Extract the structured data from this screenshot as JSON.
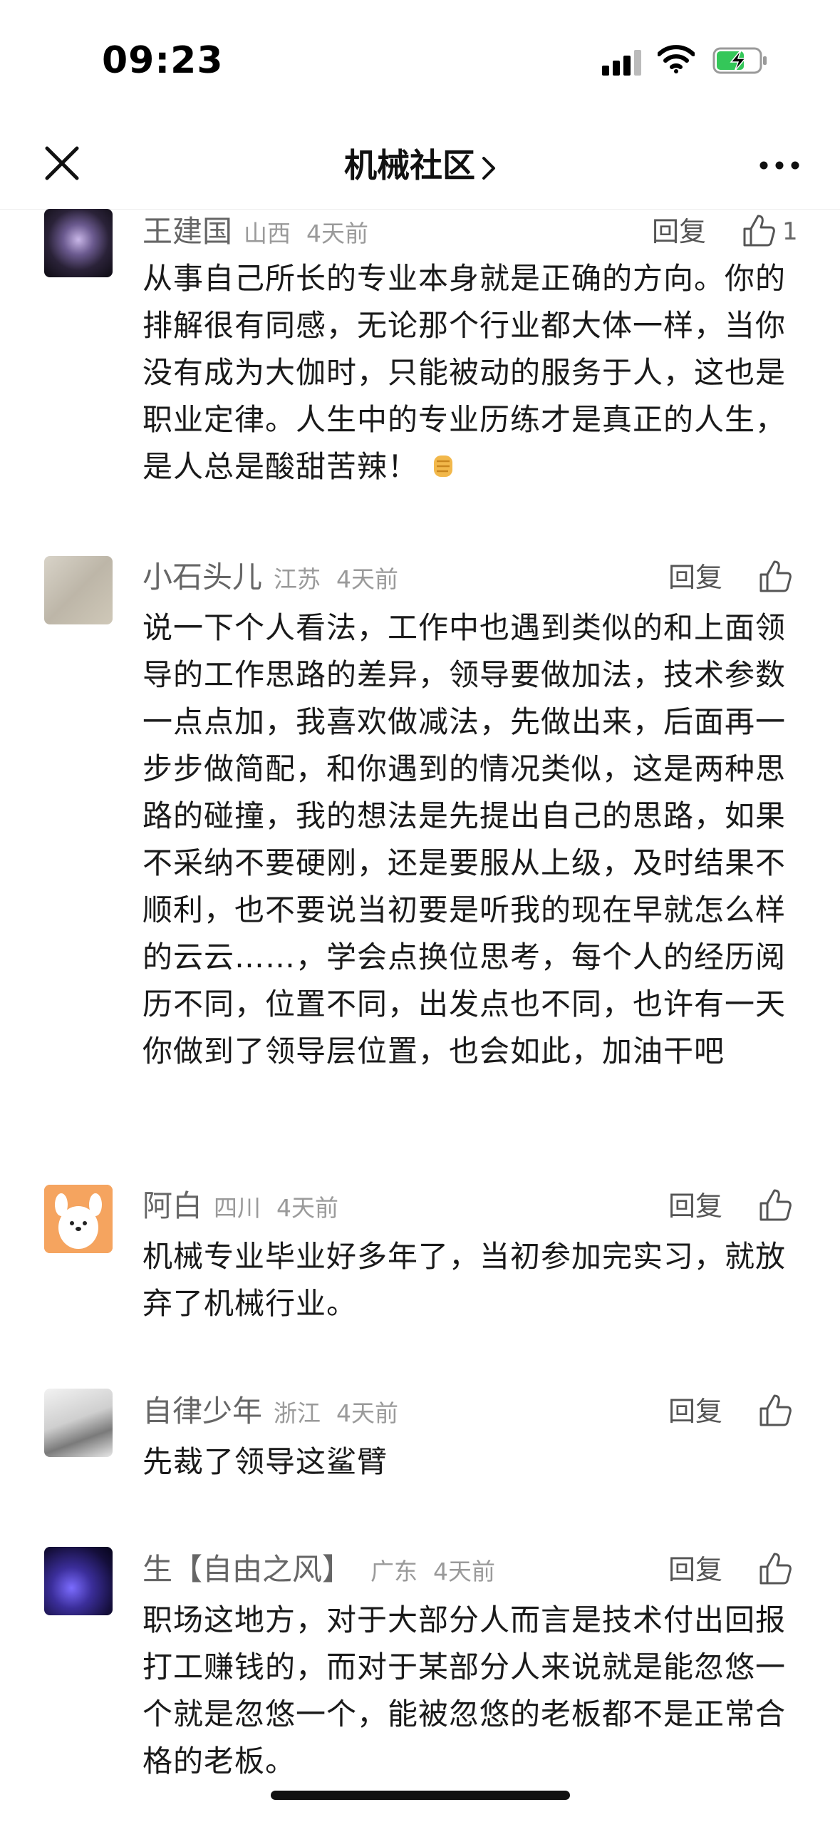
{
  "status": {
    "time": "09:23"
  },
  "nav": {
    "title": "机械社区"
  },
  "comments": [
    {
      "author": "王建国",
      "region": "山西",
      "time": "4天前",
      "reply": "回复",
      "likes": "1",
      "text": "从事自己所长的专业本身就是正确的方向。你的排解很有同感，无论那个行业都大体一样，当你没有成为大伽时，只能被动的服务于人，这也是职业定律。人生中的专业历练才是真正的人生，是人总是酸甜苦辣！"
    },
    {
      "author": "小石头儿",
      "region": "江苏",
      "time": "4天前",
      "reply": "回复",
      "text": "说一下个人看法，工作中也遇到类似的和上面领导的工作思路的差异，领导要做加法，技术参数一点点加，我喜欢做减法，先做出来，后面再一步步做简配，和你遇到的情况类似，这是两种思路的碰撞，我的想法是先提出自己的思路，如果不采纳不要硬刚，还是要服从上级，及时结果不顺利，也不要说当初要是听我的现在早就怎么样的云云……，学会点换位思考，每个人的经历阅历不同，位置不同，出发点也不同，也许有一天你做到了领导层位置，也会如此，加油干吧"
    },
    {
      "author": "阿白",
      "region": "四川",
      "time": "4天前",
      "reply": "回复",
      "text": "机械专业毕业好多年了，当初参加完实习，就放弃了机械行业。"
    },
    {
      "author": "自律少年",
      "region": "浙江",
      "time": "4天前",
      "reply": "回复",
      "text": "先裁了领导这鲨臂"
    },
    {
      "author": "生【自由之风】",
      "region": "广东",
      "time": "4天前",
      "reply": "回复",
      "text": "职场这地方，对于大部分人而言是技术付出回报打工赚钱的，而对于某部分人来说就是能忽悠一个就是忽悠一个，能被忽悠的老板都不是正常合格的老板。"
    }
  ]
}
